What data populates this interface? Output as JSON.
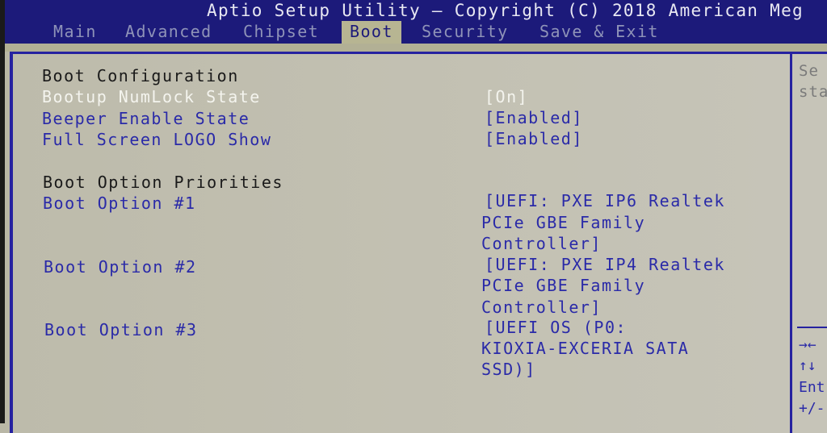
{
  "header": {
    "title": "Aptio Setup Utility – Copyright (C) 2018 American Meg"
  },
  "tabs": [
    {
      "label": "Main",
      "active": false
    },
    {
      "label": "Advanced",
      "active": false
    },
    {
      "label": "Chipset",
      "active": false
    },
    {
      "label": "Boot",
      "active": true
    },
    {
      "label": "Security",
      "active": false
    },
    {
      "label": "Save & Exit",
      "active": false
    }
  ],
  "boot_configuration": {
    "heading": "Boot Configuration",
    "items": [
      {
        "label": "Bootup NumLock State",
        "value": "[On]",
        "selected": true
      },
      {
        "label": "Beeper Enable State",
        "value": "[Enabled]",
        "selected": false
      },
      {
        "label": "Full Screen LOGO Show",
        "value": "[Enabled]",
        "selected": false
      }
    ]
  },
  "boot_priorities": {
    "heading": "Boot Option Priorities",
    "options": [
      {
        "label": "Boot Option #1",
        "value_lines": [
          "[UEFI: PXE IP6 Realtek",
          "PCIe GBE Family",
          "Controller]"
        ]
      },
      {
        "label": "Boot Option #2",
        "value_lines": [
          "[UEFI: PXE IP4 Realtek",
          "PCIe GBE Family",
          "Controller]"
        ]
      },
      {
        "label": "Boot Option #3",
        "value_lines": [
          "[UEFI OS (P0:",
          "KIOXIA-EXCERIA SATA",
          "SSD)]"
        ]
      }
    ]
  },
  "help_panel": {
    "description_lines": [
      "Se",
      "sta"
    ],
    "keys": [
      "→←",
      "↑↓",
      "Ent",
      "+/-"
    ]
  },
  "colors": {
    "header_bg": "#1c1a7a",
    "body_bg": "#c3c1b3",
    "option_text": "#2a2aa8",
    "selected_text": "#f4f4ee",
    "heading_text": "#1a1a1a"
  }
}
